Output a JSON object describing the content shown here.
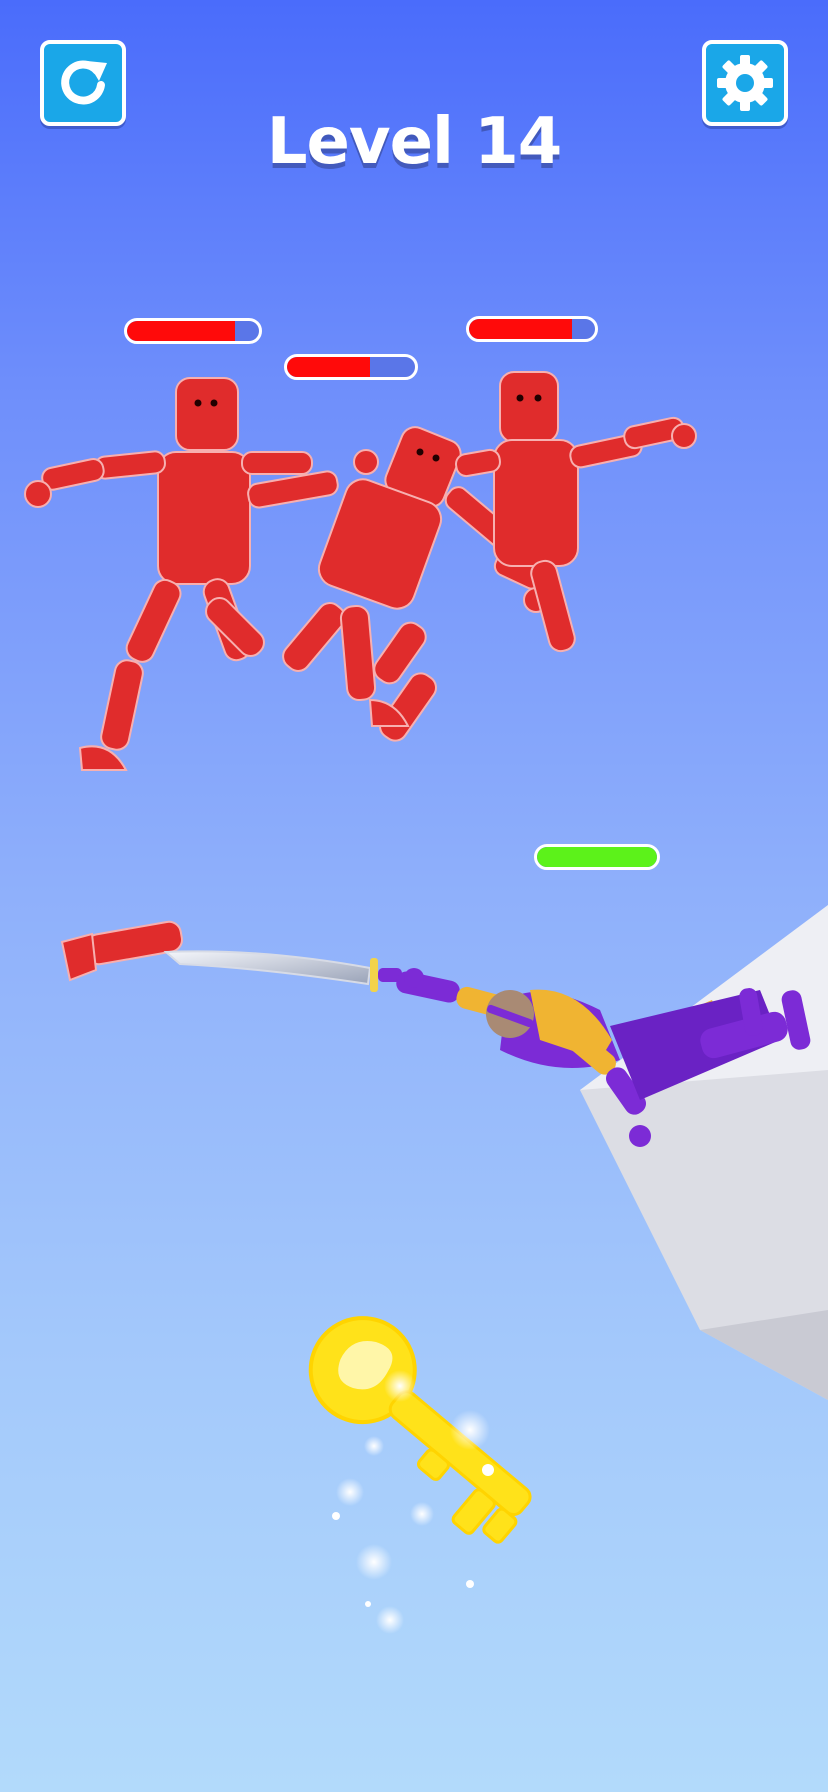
{
  "hud": {
    "level_title": "Level 14",
    "restart_icon": "restart-icon",
    "settings_icon": "gear-icon"
  },
  "colors": {
    "enemy": "#e02c2c",
    "enemy_health": "#ff0a0a",
    "player_health": "#5cf21a",
    "health_track": "#5a76e8",
    "button": "#1aa7e8",
    "key": "#ffe21a",
    "player_primary": "#7c2bd6",
    "player_secondary": "#f0b432"
  },
  "health_bars": {
    "enemy_1": 0.82,
    "enemy_2": 0.65,
    "enemy_3": 0.82,
    "player": 1.0
  }
}
